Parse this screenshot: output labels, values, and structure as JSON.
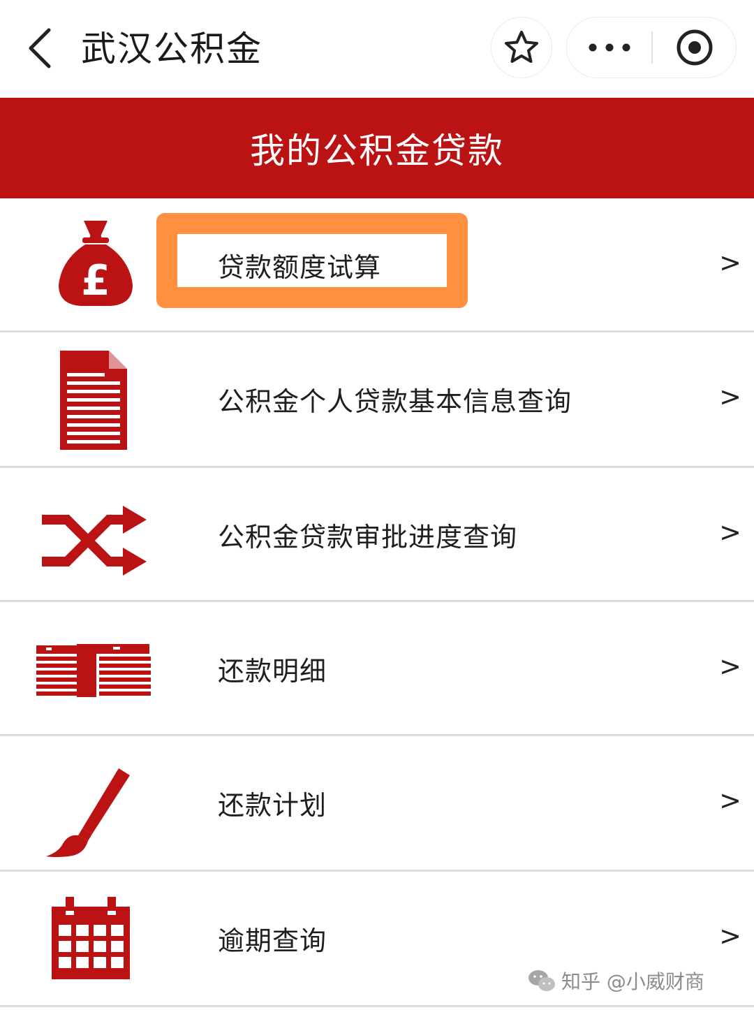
{
  "navbar": {
    "title": "武汉公积金"
  },
  "banner": {
    "title": "我的公积金贷款"
  },
  "colors": {
    "brand_red": "#bb1214",
    "highlight_orange": "#ff9040"
  },
  "menu": {
    "chevron": ">",
    "items": [
      {
        "label": "贷款额度试算",
        "icon": "money-bag-icon"
      },
      {
        "label": "公积金个人贷款基本信息查询",
        "icon": "document-icon"
      },
      {
        "label": "公积金贷款审批进度查询",
        "icon": "shuffle-icon"
      },
      {
        "label": "还款明细",
        "icon": "cash-stacks-icon"
      },
      {
        "label": "还款计划",
        "icon": "paintbrush-icon"
      },
      {
        "label": "逾期查询",
        "icon": "calendar-icon"
      }
    ]
  },
  "watermark": {
    "text": "知乎 @小威财商"
  }
}
